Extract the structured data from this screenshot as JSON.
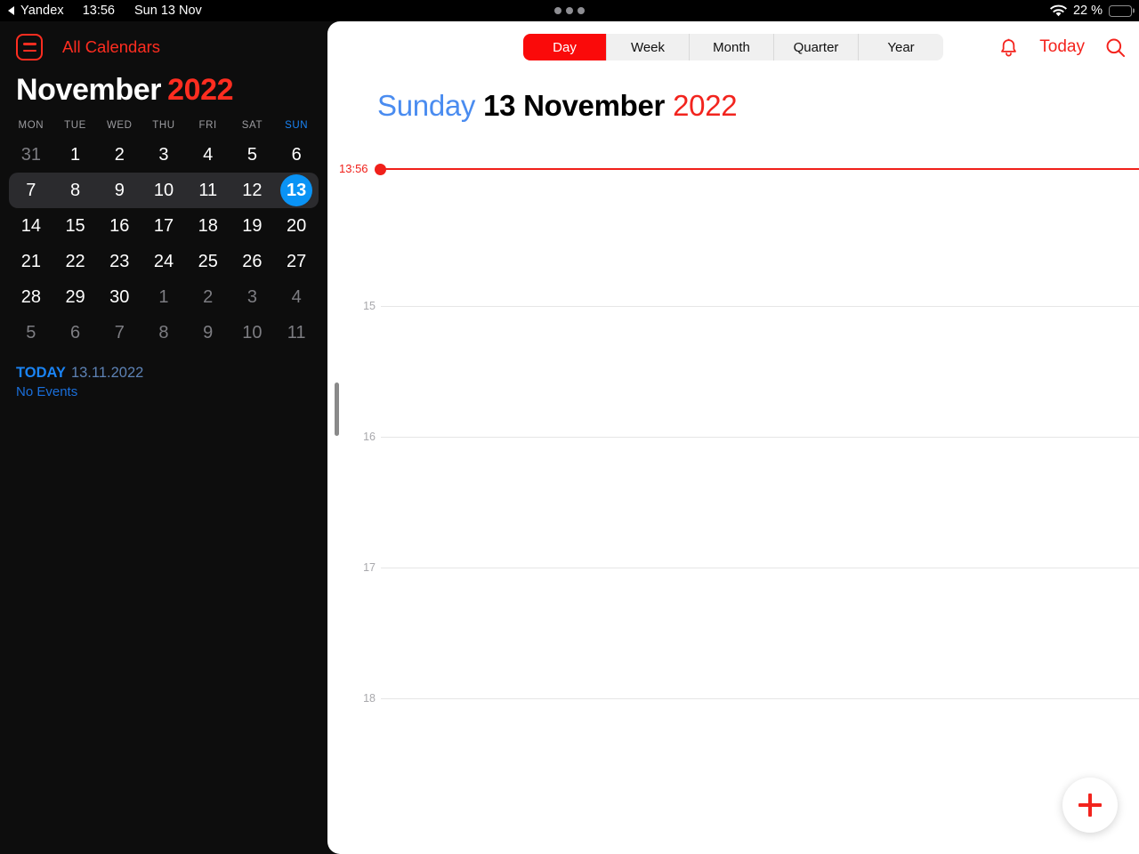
{
  "status_bar": {
    "back_app": "Yandex",
    "time": "13:56",
    "date": "Sun 13 Nov",
    "battery_percent": "22 %",
    "battery_level": 22,
    "battery_color": "#f5c518",
    "wifi_icon": "wifi-icon",
    "multitask_dots": 3
  },
  "sidebar": {
    "menu_icon": "calendar-list-icon",
    "all_calendars_label": "All Calendars",
    "month_name": "November",
    "year": "2022",
    "weekday_headers": [
      "MON",
      "TUE",
      "WED",
      "THU",
      "FRI",
      "SAT",
      "SUN"
    ],
    "weeks": [
      [
        {
          "d": "31",
          "muted": true
        },
        {
          "d": "1"
        },
        {
          "d": "2"
        },
        {
          "d": "3"
        },
        {
          "d": "4"
        },
        {
          "d": "5"
        },
        {
          "d": "6"
        }
      ],
      [
        {
          "d": "7"
        },
        {
          "d": "8"
        },
        {
          "d": "9"
        },
        {
          "d": "10"
        },
        {
          "d": "11"
        },
        {
          "d": "12"
        },
        {
          "d": "13",
          "today": true
        }
      ],
      [
        {
          "d": "14"
        },
        {
          "d": "15"
        },
        {
          "d": "16"
        },
        {
          "d": "17"
        },
        {
          "d": "18"
        },
        {
          "d": "19"
        },
        {
          "d": "20"
        }
      ],
      [
        {
          "d": "21"
        },
        {
          "d": "22"
        },
        {
          "d": "23"
        },
        {
          "d": "24"
        },
        {
          "d": "25"
        },
        {
          "d": "26"
        },
        {
          "d": "27"
        }
      ],
      [
        {
          "d": "28"
        },
        {
          "d": "29"
        },
        {
          "d": "30"
        },
        {
          "d": "1",
          "muted": true
        },
        {
          "d": "2",
          "muted": true
        },
        {
          "d": "3",
          "muted": true
        },
        {
          "d": "4",
          "muted": true
        }
      ],
      [
        {
          "d": "5",
          "muted": true
        },
        {
          "d": "6",
          "muted": true
        },
        {
          "d": "7",
          "muted": true
        },
        {
          "d": "8",
          "muted": true
        },
        {
          "d": "9",
          "muted": true
        },
        {
          "d": "10",
          "muted": true
        },
        {
          "d": "11",
          "muted": true
        }
      ]
    ],
    "current_week_index": 1,
    "today_word": "TODAY",
    "today_date": "13.11.2022",
    "events_summary": "No Events",
    "accent_red": "#ff2d20",
    "accent_blue": "#1a84f5"
  },
  "main": {
    "segments": [
      {
        "label": "Day",
        "active": true
      },
      {
        "label": "Week",
        "active": false
      },
      {
        "label": "Month",
        "active": false
      },
      {
        "label": "Quarter",
        "active": false
      },
      {
        "label": "Year",
        "active": false
      }
    ],
    "notifications_icon": "bell-icon",
    "today_button_label": "Today",
    "search_icon": "search-icon",
    "title_weekday": "Sunday",
    "title_date": "13 November",
    "title_year": "2022",
    "current_time_label": "13:56",
    "hour_labels": [
      "15",
      "16",
      "17",
      "18"
    ],
    "add_event_icon": "plus-icon",
    "selected_segment_color": "#fa0a0a",
    "now_indicator_color": "#f0201a"
  }
}
